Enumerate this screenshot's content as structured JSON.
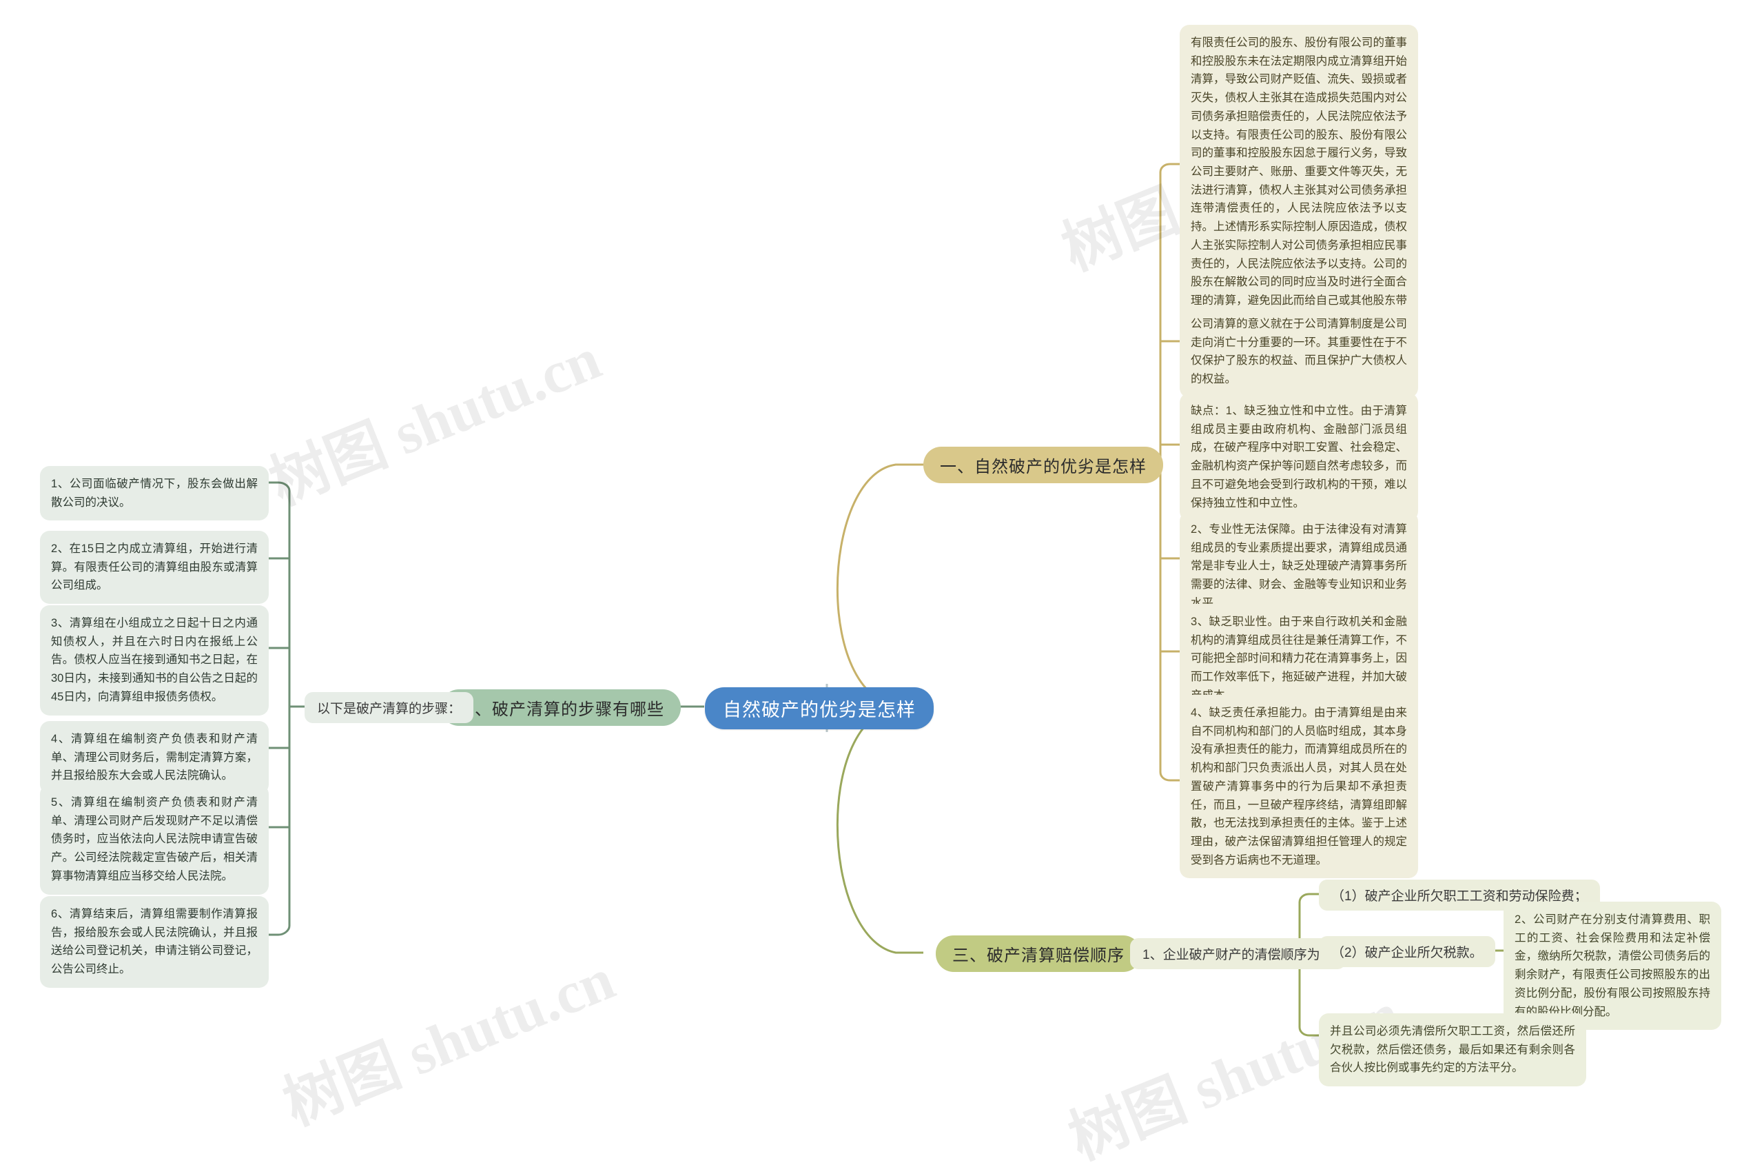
{
  "root": {
    "label": "自然破产的优劣是怎样",
    "color": "#4a86c8"
  },
  "watermark": {
    "text": "树图 shutu.cn"
  },
  "branches": [
    {
      "id": "branch-1",
      "label": "一、自然破产的优劣是怎样",
      "color": "#d9c88a",
      "leaves": [
        {
          "id": "b1-leaf-1",
          "text": "有限责任公司的股东、股份有限公司的董事和控股股东未在法定期限内成立清算组开始清算，导致公司财产贬值、流失、毁损或者灭失，债权人主张其在造成损失范围内对公司债务承担赔偿责任的，人民法院应依法予以支持。有限责任公司的股东、股份有限公司的董事和控股股东因怠于履行义务，导致公司主要财产、账册、重要文件等灭失，无法进行清算，债权人主张其对公司债务承担连带清偿责任的，人民法院应依法予以支持。上述情形系实际控制人原因造成，债权人主张实际控制人对公司债务承担相应民事责任的，人民法院应依法予以支持。公司的股东在解散公司的同时应当及时进行全面合理的清算，避免因此而给自己或其他股东带来损失。"
        },
        {
          "id": "b1-leaf-2",
          "text": "公司清算的意义就在于公司清算制度是公司走向消亡十分重要的一环。其重要性在于不仅保护了股东的权益、而且保护广大债权人的权益。"
        },
        {
          "id": "b1-leaf-3",
          "text": "缺点：1、缺乏独立性和中立性。由于清算组成员主要由政府机构、金融部门派员组成，在破产程序中对职工安置、社会稳定、金融机构资产保护等问题自然考虑较多，而且不可避免地会受到行政机构的干预，难以保持独立性和中立性。"
        },
        {
          "id": "b1-leaf-4",
          "text": "2、专业性无法保障。由于法律没有对清算组成员的专业素质提出要求，清算组成员通常是非专业人士，缺乏处理破产清算事务所需要的法律、财会、金融等专业知识和业务水平。"
        },
        {
          "id": "b1-leaf-5",
          "text": "3、缺乏职业性。由于来自行政机关和金融机构的清算组成员往往是兼任清算工作，不可能把全部时间和精力花在清算事务上，因而工作效率低下，拖延破产进程，并加大破产成本。"
        },
        {
          "id": "b1-leaf-6",
          "text": "4、缺乏责任承担能力。由于清算组是由来自不同机构和部门的人员临时组成，其本身没有承担责任的能力，而清算组成员所在的机构和部门只负责派出人员，对其人员在处置破产清算事务中的行为后果却不承担责任，而且，一旦破产程序终结，清算组即解散，也无法找到承担责任的主体。鉴于上述理由，破产法保留清算组担任管理人的规定受到各方诟病也不无道理。"
        }
      ]
    },
    {
      "id": "branch-2",
      "label": "二、破产清算的步骤有哪些",
      "color": "#a5c7ab",
      "sub_label": "以下是破产清算的步骤：",
      "leaves": [
        {
          "id": "b2-leaf-1",
          "text": "1、公司面临破产情况下，股东会做出解散公司的决议。"
        },
        {
          "id": "b2-leaf-2",
          "text": "2、在15日之内成立清算组，开始进行清算。有限责任公司的清算组由股东或清算公司组成。"
        },
        {
          "id": "b2-leaf-3",
          "text": "3、清算组在小组成立之日起十日之内通知债权人，并且在六时日内在报纸上公告。债权人应当在接到通知书之日起，在30日内，未接到通知书的自公告之日起的45日内，向清算组申报债务债权。"
        },
        {
          "id": "b2-leaf-4",
          "text": "4、清算组在编制资产负债表和财产清单、清理公司财务后，需制定清算方案，并且报给股东大会或人民法院确认。"
        },
        {
          "id": "b2-leaf-5",
          "text": "5、清算组在编制资产负债表和财产清单、清理公司财产后发现财产不足以清偿债务时，应当依法向人民法院申请宣告破产。公司经法院裁定宣告破产后，相关清算事物清算组应当移交给人民法院。"
        },
        {
          "id": "b2-leaf-6",
          "text": "6、清算结束后，清算组需要制作清算报告，报给股东会或人民法院确认，并且报送给公司登记机关，申请注销公司登记，公告公司终止。"
        }
      ]
    },
    {
      "id": "branch-3",
      "label": "三、破产清算赔偿顺序",
      "color": "#c1cb83",
      "sub_label": "1、企业破产财产的清偿顺序为：",
      "order_items": [
        {
          "id": "b3-item-1",
          "text": "（1）破产企业所欠职工工资和劳动保险费；"
        },
        {
          "id": "b3-item-2",
          "text": "（2）破产企业所欠税款。"
        }
      ],
      "leaves": [
        {
          "id": "b3-leaf-1",
          "text": "2、公司财产在分别支付清算费用、职工的工资、社会保险费用和法定补偿金，缴纳所欠税款，清偿公司债务后的剩余财产，有限责任公司按照股东的出资比例分配，股份有限公司按照股东持有的股份比例分配。"
        },
        {
          "id": "b3-leaf-2",
          "text": "并且公司必须先清偿所欠职工工资，然后偿还所欠税款，然后偿还债务，最后如果还有剩余则各合伙人按比例或事先约定的方法平分。"
        }
      ]
    }
  ],
  "edge_colors": {
    "branch_1": "#c7b169",
    "branch_2": "#6f9076",
    "branch_3": "#9aa85c",
    "root_stub": "#6f9076"
  }
}
